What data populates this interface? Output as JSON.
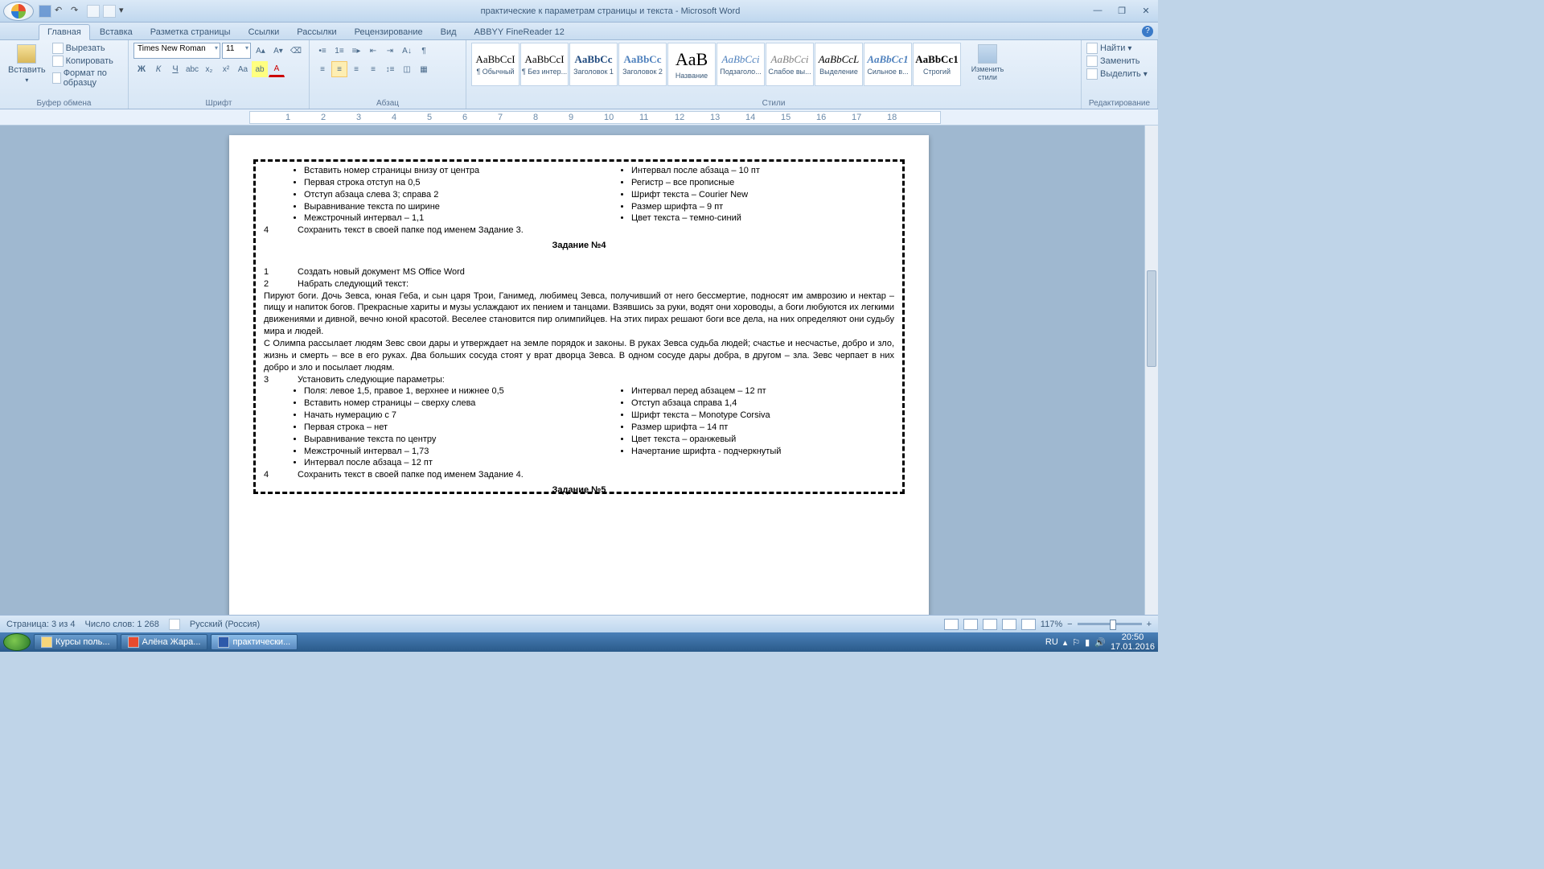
{
  "window": {
    "title": "практические к параметрам страницы и текста - Microsoft Word"
  },
  "tabs": [
    "Главная",
    "Вставка",
    "Разметка страницы",
    "Ссылки",
    "Рассылки",
    "Рецензирование",
    "Вид",
    "ABBYY FineReader 12"
  ],
  "ribbon": {
    "clipboard": {
      "label": "Буфер обмена",
      "paste": "Вставить",
      "cut": "Вырезать",
      "copy": "Копировать",
      "format": "Формат по образцу"
    },
    "font": {
      "label": "Шрифт",
      "name": "Times New Roman",
      "size": "11"
    },
    "paragraph": {
      "label": "Абзац"
    },
    "styles": {
      "label": "Стили",
      "items": [
        {
          "prev": "AaBbCcI",
          "name": "¶ Обычный"
        },
        {
          "prev": "AaBbCcI",
          "name": "¶ Без интер..."
        },
        {
          "prev": "AaBbCc",
          "name": "Заголовок 1",
          "color": "#1f497d",
          "bold": true
        },
        {
          "prev": "AaBbCc",
          "name": "Заголовок 2",
          "color": "#4f81bd",
          "bold": true
        },
        {
          "prev": "AaB",
          "name": "Название",
          "big": true
        },
        {
          "prev": "AaBbCci",
          "name": "Подзаголо...",
          "color": "#4f81bd",
          "italic": true
        },
        {
          "prev": "AaBbCci",
          "name": "Слабое вы...",
          "italic": true,
          "color": "#808080"
        },
        {
          "prev": "AaBbCcL",
          "name": "Выделение",
          "italic": true
        },
        {
          "prev": "AaBbCc1",
          "name": "Сильное в...",
          "color": "#4f81bd",
          "bold": true,
          "italic": true
        },
        {
          "prev": "AaBbCc1",
          "name": "Строгий",
          "bold": true
        }
      ],
      "change": "Изменить стили"
    },
    "editing": {
      "label": "Редактирование",
      "find": "Найти",
      "replace": "Заменить",
      "select": "Выделить"
    }
  },
  "ruler_marks": [
    "",
    "1",
    "2",
    "3",
    "4",
    "5",
    "6",
    "7",
    "8",
    "9",
    "10",
    "11",
    "12",
    "13",
    "14",
    "15",
    "16",
    "17",
    "18"
  ],
  "document": {
    "leftA": [
      "Вставить номер страницы внизу от центра",
      "Первая строка отступ на 0,5",
      "Отступ абзаца слева  3; справа  2",
      "Выравнивание текста по ширине",
      "Межстрочный интервал – 1,1"
    ],
    "rightA": [
      "Интервал после абзаца – 10 пт",
      "Регистр – все прописные",
      "Шрифт текста – Courier New",
      "Размер шрифта – 9 пт",
      "Цвет текста – темно-синий"
    ],
    "line4": "Сохранить текст в своей папке под именем Задание 3.",
    "title4": "Задание №4",
    "n1": "Создать новый документ MS Office Word",
    "n2": "Набрать следующий текст:",
    "para1": "Пируют боги. Дочь Зевса, юная Геба, и сын царя Трои, Ганимед, любимец Зевса, получивший от него бессмертие, подносят им амврозию и нектар – пищу и напиток богов. Прекрасные хариты и музы услаждают их пением и танцами. Взявшись за руки, водят они хороводы, а боги любуются их легкими движениями и дивной, вечно юной красотой. Веселее становится пир олимпийцев. На этих пирах решают боги все дела, на них определяют они судьбу мира и людей.",
    "para2": "С Олимпа рассылает людям Зевс свои дары и утверждает на земле порядок и законы. В руках Зевса судьба людей; счастье и несчастье, добро и зло, жизнь и смерть – все в его руках. Два больших сосуда стоят у врат дворца Зевса. В одном сосуде дары добра, в другом – зла. Зевс черпает в них добро и зло и посылает людям.",
    "n3": "Установить следующие параметры:",
    "leftB": [
      "Поля: левое  1,5, правое  1, верхнее и нижнее  0,5",
      "Вставить номер страницы – сверху слева",
      "Начать нумерацию с 7",
      "Первая строка – нет",
      "Выравнивание текста по центру",
      "Межстрочный интервал – 1,73",
      "Интервал после абзаца – 12 пт"
    ],
    "rightB": [
      "Интервал перед абзацем – 12 пт",
      "Отступ абзаца справа  1,4",
      "Шрифт текста – Monotype Corsiva",
      "Размер шрифта – 14 пт",
      "Цвет текста – оранжевый",
      "Начертание шрифта - подчеркнутый"
    ],
    "line4b": "Сохранить текст в своей папке под именем Задание 4.",
    "title5": "Задание №5"
  },
  "status": {
    "page": "Страница: 3 из 4",
    "words": "Число слов: 1 268",
    "lang": "Русский (Россия)",
    "zoom": "117%"
  },
  "taskbar": {
    "items": [
      "Курсы поль...",
      "Алёна Жара...",
      "практически..."
    ],
    "lang": "RU",
    "time": "20:50",
    "date": "17.01.2016"
  }
}
